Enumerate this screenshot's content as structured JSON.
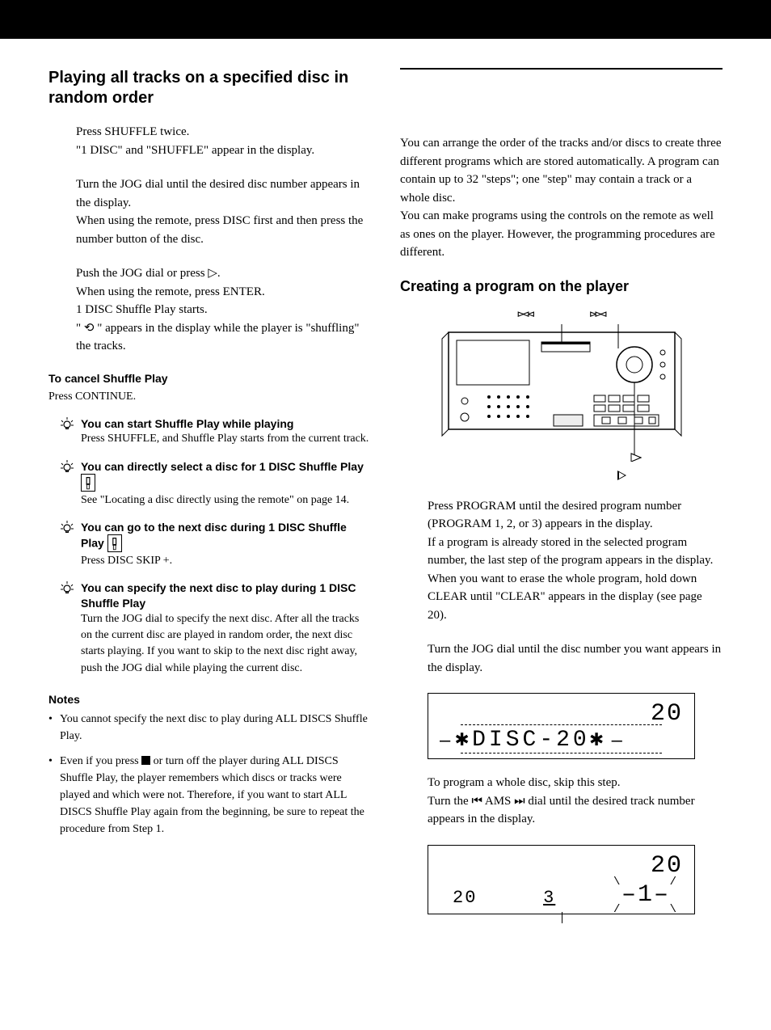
{
  "left": {
    "heading": "Playing all tracks on a specified disc in random order",
    "steps": [
      "Press SHUFFLE twice.\n\"1 DISC\" and \"SHUFFLE\" appear in the display.",
      "Turn the JOG dial until the desired disc number appears in the display.\nWhen using the remote, press DISC first and then press the number button of the disc.",
      "Push the JOG dial or press ▷.\nWhen using the remote, press ENTER.\n1 DISC Shuffle Play starts.\n\" ⟲ \" appears in the display while the player is \"shuffling\" the tracks."
    ],
    "cancel_h": "To cancel Shuffle Play",
    "cancel_p": "Press CONTINUE.",
    "tips": [
      {
        "title": "You can start Shuffle Play while playing",
        "body": "Press SHUFFLE, and Shuffle Play starts from the current track.",
        "remote": false
      },
      {
        "title": "You can directly select a disc for 1 DISC Shuffle Play",
        "body": "See \"Locating a disc directly using the remote\" on page 14.",
        "remote": true
      },
      {
        "title": "You can go to the next disc during 1 DISC Shuffle Play",
        "body": "Press DISC SKIP +.",
        "remote": true
      },
      {
        "title": "You can specify the next disc to play during 1 DISC Shuffle Play",
        "body": "Turn the JOG dial to specify the next disc. After all the tracks on the current disc are played in random order, the next disc starts playing. If you want to skip to the next disc right away, push the JOG dial while playing the current disc.",
        "remote": false
      }
    ],
    "notes_h": "Notes",
    "notes": [
      "You cannot specify the next disc to play during ALL DISCS Shuffle Play.",
      "Even if you press ■ or turn off the player during ALL DISCS Shuffle Play, the player remembers which discs or tracks were played and which were not. Therefore, if you want to start ALL DISCS Shuffle Play again from the beginning, be sure to repeat the procedure from Step 1."
    ]
  },
  "right": {
    "intro": "You can arrange the order of the tracks and/or discs to create three different programs which are stored automatically. A program can contain up to 32 \"steps\"; one \"step\" may contain a track or a whole disc.\nYou can make programs using the controls on the remote as well as ones on the player. However, the programming procedures are different.",
    "heading": "Creating a program on the player",
    "device_labels": {
      "prev": "⏮",
      "next": "⏭",
      "play": "▷"
    },
    "steps": [
      "Press PROGRAM until the desired program number (PROGRAM 1, 2, or 3) appears in the display.\nIf a program is already stored in the selected program number, the last step of the program appears in the display. When you want to erase the whole program, hold down CLEAR until \"CLEAR\" appears in the display (see page 20).",
      "Turn the JOG dial until the disc number you want appears in the display.",
      "To program a whole disc, skip this step.\nTurn the ⏮ AMS ⏭ dial until the desired track number appears in the display."
    ],
    "display1": {
      "top_right": "20",
      "main": "✱DISC-20✱"
    },
    "display2": {
      "top_right": "20",
      "left": "20",
      "mid": "3",
      "right": "1"
    }
  }
}
